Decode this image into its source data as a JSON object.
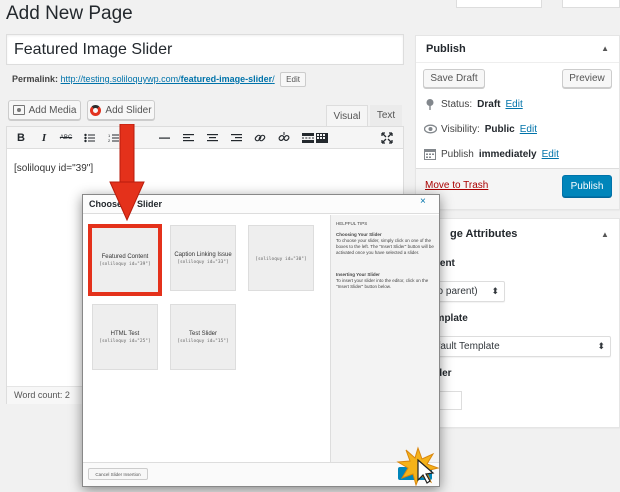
{
  "page": {
    "heading": "Add New Page",
    "title_value": "Featured Image Slider"
  },
  "permalink": {
    "label": "Permalink:",
    "url_base": "http://testing.soliloquywp.com/",
    "url_slug": "featured-image-slider",
    "url_end": "/",
    "edit_label": "Edit"
  },
  "media_buttons": {
    "add_media": "Add Media",
    "add_slider": "Add Slider"
  },
  "editor": {
    "tab_visual": "Visual",
    "tab_text": "Text",
    "content": "[soliloquy id=\"39\"]",
    "word_count": "Word count: 2",
    "toolbar": {
      "bold": "B",
      "italic": "I",
      "strike": "ABC"
    }
  },
  "publish_box": {
    "title": "Publish",
    "save_draft": "Save Draft",
    "preview": "Preview",
    "status_label": "Status:",
    "status_value": "Draft",
    "visibility_label": "Visibility:",
    "visibility_value": "Public",
    "publish_label": "Publish",
    "publish_value": "immediately",
    "edit": "Edit",
    "move_to_trash": "Move to Trash",
    "publish_button": "Publish"
  },
  "page_attributes": {
    "title": "ge Attributes",
    "parent_label": "rent",
    "parent_value": "no parent)",
    "template_label": "emplate",
    "template_value": "efault Template",
    "order_label": "der"
  },
  "modal": {
    "title_start": "Choose",
    "title_end": "Slider",
    "close": "×",
    "help_heading": "HELPFUL TIPS",
    "help_choose_title": "Choosing Your Slider",
    "help_choose_text": "To choose your slider, simply click on one of the boxes to the left. The \"Insert Slider\" button will be activated once you have selected a slider.",
    "help_insert_title": "Inserting Your Slider",
    "help_insert_text": "To insert your slider into the editor, click on the \"Insert Slider\" button below.",
    "cancel_label": "Cancel Slider Insertion",
    "sliders": [
      {
        "name": "Featured Content",
        "code": "[soliloquy id=\"39\"]"
      },
      {
        "name": "Caption Linking Issue",
        "code": "[soliloquy id=\"33\"]"
      },
      {
        "name": "",
        "code": "[soliloquy id=\"30\"]"
      },
      {
        "name": "HTML Test",
        "code": "[soliloquy id=\"25\"]"
      },
      {
        "name": "Test Slider",
        "code": "[soliloquy id=\"15\"]"
      }
    ]
  },
  "colors": {
    "accent_blue": "#0085ba",
    "link_blue": "#0073aa",
    "highlight_red": "#e4311b",
    "trash_red": "#aa0000"
  }
}
